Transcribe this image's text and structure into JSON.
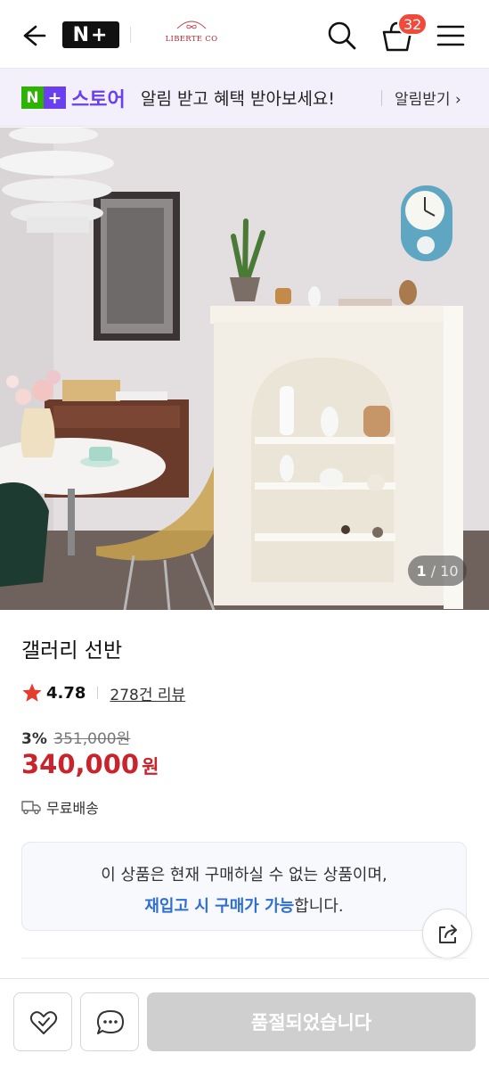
{
  "topnav": {
    "logo_text": "N+",
    "brand_name": "LIBERTE CO",
    "cart_count": "32",
    "icons": [
      "back-arrow-icon",
      "search-icon",
      "cart-icon",
      "menu-icon"
    ]
  },
  "banner": {
    "logo_n": "N",
    "logo_plus": "+",
    "store_label": "스토어",
    "message": "알림 받고 혜택 받아보세요!",
    "cta": "알림받기 ›"
  },
  "gallery": {
    "current": "1",
    "total": "/ 10"
  },
  "product": {
    "title": "갤러리 선반",
    "rating": "4.78",
    "reviews": "278건 리뷰",
    "discount": "3%",
    "original_price": "351,000원",
    "price": "340,000",
    "currency": "원",
    "shipping": "무료배송"
  },
  "notice": {
    "line1": "이 상품은 현재 구매하실 수 없는 상품이며,",
    "line2_highlight": "재입고 시 구매가 가능",
    "line2_rest": "합니다."
  },
  "bottom": {
    "soldout_label": "품절되었습니다"
  },
  "colors": {
    "accent_red": "#c9232c",
    "naver_green": "#2db400",
    "plus_purple": "#6a3ff0",
    "badge_red": "#ef4a3a",
    "link_blue": "#2f6fd3"
  }
}
